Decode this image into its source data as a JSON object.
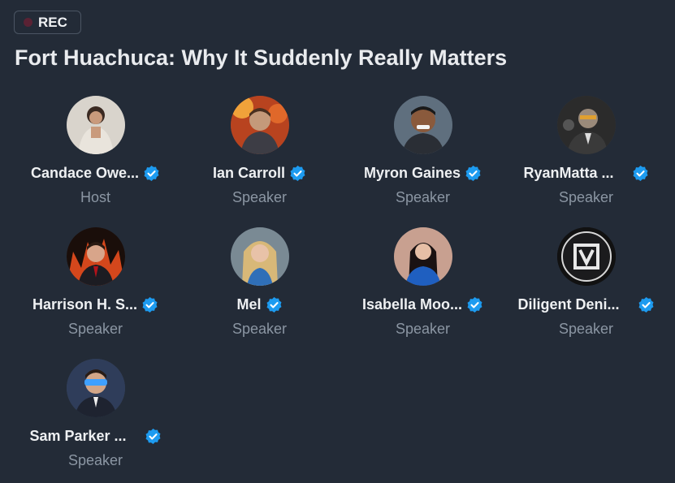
{
  "recording": {
    "label": "REC"
  },
  "space": {
    "title": "Fort Huachuca: Why It Suddenly Really Matters"
  },
  "participants": [
    {
      "name": "Candace Owe...",
      "role": "Host",
      "verified": true
    },
    {
      "name": "Ian Carroll",
      "role": "Speaker",
      "verified": true
    },
    {
      "name": "Myron Gaines",
      "role": "Speaker",
      "verified": true
    },
    {
      "name": "RyanMatta ...",
      "role": "Speaker",
      "verified": true
    },
    {
      "name": "Harrison H. S...",
      "role": "Speaker",
      "verified": true
    },
    {
      "name": "Mel",
      "role": "Speaker",
      "verified": true
    },
    {
      "name": "Isabella Moo...",
      "role": "Speaker",
      "verified": true
    },
    {
      "name": "Diligent Deni...",
      "role": "Speaker",
      "verified": true
    },
    {
      "name": "Sam Parker ...",
      "role": "Speaker",
      "verified": true
    }
  ],
  "colors": {
    "background": "#232b37",
    "verified": "#1d9bf0",
    "role_text": "#8b96a3"
  }
}
